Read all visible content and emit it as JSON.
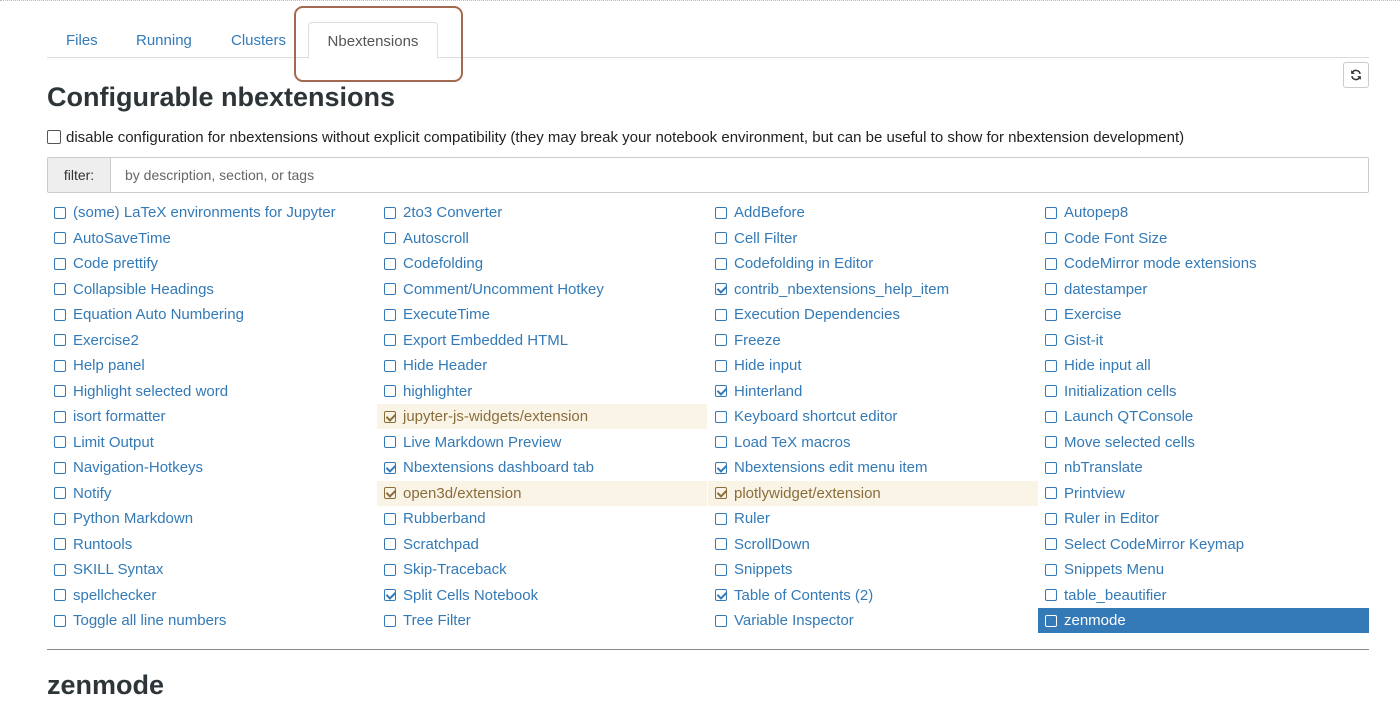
{
  "tabs": [
    {
      "label": "Files",
      "active": false
    },
    {
      "label": "Running",
      "active": false
    },
    {
      "label": "Clusters",
      "active": false
    },
    {
      "label": "Nbextensions",
      "active": true
    }
  ],
  "page_title": "Configurable nbextensions",
  "compat_checkbox": {
    "checked": false,
    "label": "disable configuration for nbextensions without explicit compatibility (they may break your notebook environment, but can be useful to show for nbextension development)"
  },
  "filter": {
    "label": "filter:",
    "placeholder": "by description, section, or tags",
    "value": ""
  },
  "extensions": [
    {
      "label": "(some) LaTeX environments for Jupyter",
      "checked": false
    },
    {
      "label": "2to3 Converter",
      "checked": false
    },
    {
      "label": "AddBefore",
      "checked": false
    },
    {
      "label": "Autopep8",
      "checked": false
    },
    {
      "label": "AutoSaveTime",
      "checked": false
    },
    {
      "label": "Autoscroll",
      "checked": false
    },
    {
      "label": "Cell Filter",
      "checked": false
    },
    {
      "label": "Code Font Size",
      "checked": false
    },
    {
      "label": "Code prettify",
      "checked": false
    },
    {
      "label": "Codefolding",
      "checked": false
    },
    {
      "label": "Codefolding in Editor",
      "checked": false
    },
    {
      "label": "CodeMirror mode extensions",
      "checked": false
    },
    {
      "label": "Collapsible Headings",
      "checked": false
    },
    {
      "label": "Comment/Uncomment Hotkey",
      "checked": false
    },
    {
      "label": "contrib_nbextensions_help_item",
      "checked": true
    },
    {
      "label": "datestamper",
      "checked": false
    },
    {
      "label": "Equation Auto Numbering",
      "checked": false
    },
    {
      "label": "ExecuteTime",
      "checked": false
    },
    {
      "label": "Execution Dependencies",
      "checked": false
    },
    {
      "label": "Exercise",
      "checked": false
    },
    {
      "label": "Exercise2",
      "checked": false
    },
    {
      "label": "Export Embedded HTML",
      "checked": false
    },
    {
      "label": "Freeze",
      "checked": false
    },
    {
      "label": "Gist-it",
      "checked": false
    },
    {
      "label": "Help panel",
      "checked": false
    },
    {
      "label": "Hide Header",
      "checked": false
    },
    {
      "label": "Hide input",
      "checked": false
    },
    {
      "label": "Hide input all",
      "checked": false
    },
    {
      "label": "Highlight selected word",
      "checked": false
    },
    {
      "label": "highlighter",
      "checked": false
    },
    {
      "label": "Hinterland",
      "checked": true
    },
    {
      "label": "Initialization cells",
      "checked": false
    },
    {
      "label": "isort formatter",
      "checked": false
    },
    {
      "label": "jupyter-js-widgets/extension",
      "checked": true,
      "compat_warning": true
    },
    {
      "label": "Keyboard shortcut editor",
      "checked": false
    },
    {
      "label": "Launch QTConsole",
      "checked": false
    },
    {
      "label": "Limit Output",
      "checked": false
    },
    {
      "label": "Live Markdown Preview",
      "checked": false
    },
    {
      "label": "Load TeX macros",
      "checked": false
    },
    {
      "label": "Move selected cells",
      "checked": false
    },
    {
      "label": "Navigation-Hotkeys",
      "checked": false
    },
    {
      "label": "Nbextensions dashboard tab",
      "checked": true
    },
    {
      "label": "Nbextensions edit menu item",
      "checked": true
    },
    {
      "label": "nbTranslate",
      "checked": false
    },
    {
      "label": "Notify",
      "checked": false
    },
    {
      "label": "open3d/extension",
      "checked": true,
      "compat_warning": true
    },
    {
      "label": "plotlywidget/extension",
      "checked": true,
      "compat_warning": true
    },
    {
      "label": "Printview",
      "checked": false
    },
    {
      "label": "Python Markdown",
      "checked": false
    },
    {
      "label": "Rubberband",
      "checked": false
    },
    {
      "label": "Ruler",
      "checked": false
    },
    {
      "label": "Ruler in Editor",
      "checked": false
    },
    {
      "label": "Runtools",
      "checked": false
    },
    {
      "label": "Scratchpad",
      "checked": false
    },
    {
      "label": "ScrollDown",
      "checked": false
    },
    {
      "label": "Select CodeMirror Keymap",
      "checked": false
    },
    {
      "label": "SKILL Syntax",
      "checked": false
    },
    {
      "label": "Skip-Traceback",
      "checked": false
    },
    {
      "label": "Snippets",
      "checked": false
    },
    {
      "label": "Snippets Menu",
      "checked": false
    },
    {
      "label": "spellchecker",
      "checked": false
    },
    {
      "label": "Split Cells Notebook",
      "checked": true
    },
    {
      "label": "Table of Contents (2)",
      "checked": true
    },
    {
      "label": "table_beautifier",
      "checked": false
    },
    {
      "label": "Toggle all line numbers",
      "checked": false
    },
    {
      "label": "Tree Filter",
      "checked": false
    },
    {
      "label": "Variable Inspector",
      "checked": false
    },
    {
      "label": "zenmode",
      "checked": false,
      "selected": true
    }
  ],
  "section_title": "zenmode",
  "colors": {
    "link": "#337ab7",
    "selected_bg": "#337ab7",
    "compat_warning_bg": "#faf4e7",
    "highlight_box": "#a26a52"
  },
  "icons": {
    "refresh": "refresh-icon"
  }
}
